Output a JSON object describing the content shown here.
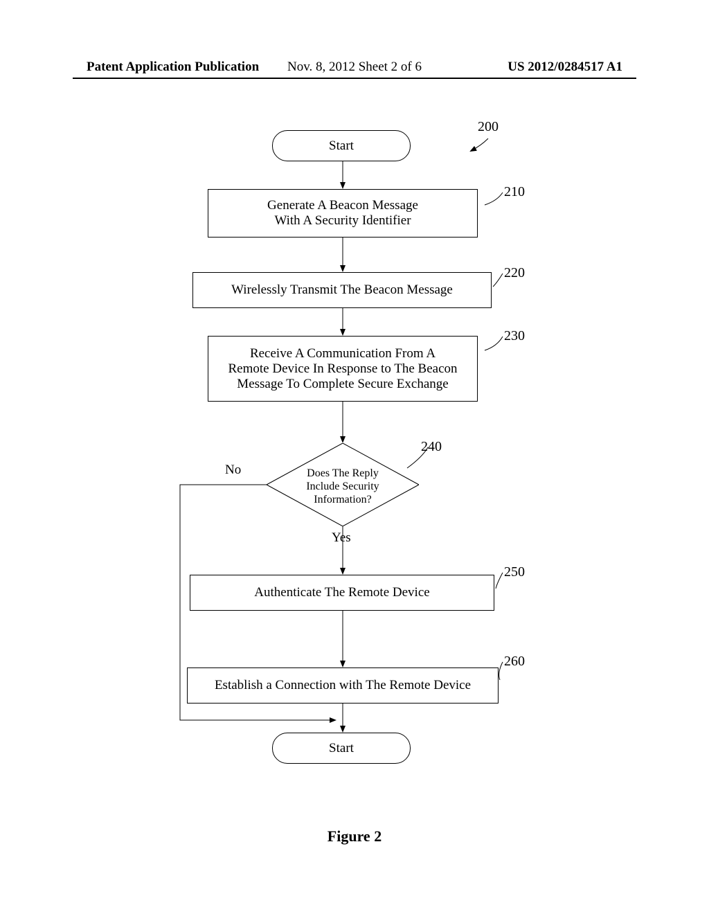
{
  "header": {
    "left": "Patent Application Publication",
    "center": "Nov. 8, 2012  Sheet 2 of 6",
    "right": "US 2012/0284517 A1"
  },
  "flowchart": {
    "ref_diagram": "200",
    "start_top": "Start",
    "start_bottom": "Start",
    "steps": {
      "p210": {
        "ref": "210",
        "line1": "Generate A Beacon Message",
        "line2": "With A Security Identifier"
      },
      "p220": {
        "ref": "220",
        "text": "Wirelessly Transmit The Beacon Message"
      },
      "p230": {
        "ref": "230",
        "line1": "Receive A Communication From A",
        "line2": "Remote Device In Response to The Beacon",
        "line3": "Message To Complete Secure Exchange"
      },
      "d240": {
        "ref": "240",
        "line1": "Does The Reply",
        "line2": "Include Security",
        "line3": "Information?",
        "no": "No",
        "yes": "Yes"
      },
      "p250": {
        "ref": "250",
        "text": "Authenticate The Remote Device"
      },
      "p260": {
        "ref": "260",
        "text": "Establish a Connection with The Remote Device"
      }
    }
  },
  "figure_label": "Figure 2"
}
